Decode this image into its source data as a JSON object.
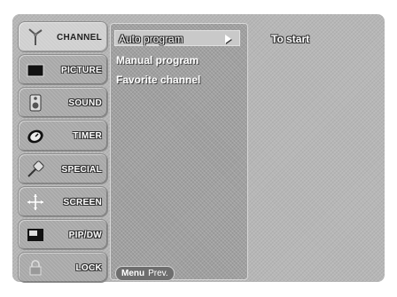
{
  "sidebar": {
    "items": [
      {
        "label": "CHANNEL",
        "icon": "antenna-icon",
        "active": true
      },
      {
        "label": "PICTURE",
        "icon": "picture-icon",
        "active": false
      },
      {
        "label": "SOUND",
        "icon": "speaker-icon",
        "active": false
      },
      {
        "label": "TIMER",
        "icon": "clock-icon",
        "active": false
      },
      {
        "label": "SPECIAL",
        "icon": "satellite-icon",
        "active": false
      },
      {
        "label": "SCREEN",
        "icon": "move-icon",
        "active": false
      },
      {
        "label": "PIP/DW",
        "icon": "pip-icon",
        "active": false
      },
      {
        "label": "LOCK",
        "icon": "lock-icon",
        "active": false
      }
    ]
  },
  "submenu": {
    "items": [
      {
        "label": "Auto program",
        "selected": true
      },
      {
        "label": "Manual program",
        "selected": false
      },
      {
        "label": "Favorite channel",
        "selected": false
      }
    ]
  },
  "detail": {
    "label": "To start"
  },
  "footer": {
    "menu_label": "Menu",
    "prev_label": "Prev."
  }
}
